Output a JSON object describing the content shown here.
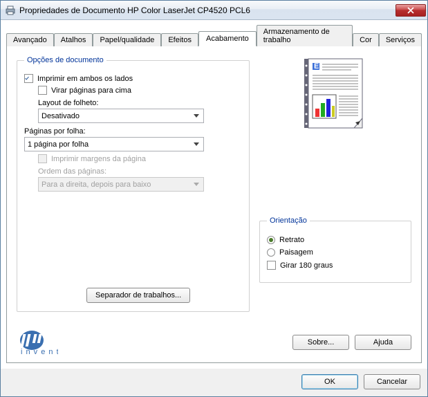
{
  "window": {
    "title": "Propriedades de Documento HP Color LaserJet CP4520 PCL6"
  },
  "tabs": {
    "items": [
      "Avançado",
      "Atalhos",
      "Papel/qualidade",
      "Efeitos",
      "Acabamento",
      "Armazenamento de trabalho",
      "Cor",
      "Serviços"
    ],
    "active_index": 4
  },
  "doc_options": {
    "legend": "Opções de documento",
    "print_both_sides": {
      "label": "Imprimir em ambos os lados",
      "checked": true
    },
    "flip_pages_up": {
      "label": "Virar páginas para cima",
      "checked": false
    },
    "booklet_layout_label": "Layout de folheto:",
    "booklet_layout_value": "Desativado",
    "pages_per_sheet_label": "Páginas por folha:",
    "pages_per_sheet_value": "1 página por folha",
    "print_page_borders": {
      "label": "Imprimir margens da página",
      "checked": false,
      "disabled": true
    },
    "page_order_label": "Ordem das páginas:",
    "page_order_value": "Para a direita, depois para baixo",
    "separator_button": "Separador de trabalhos..."
  },
  "orientation": {
    "legend": "Orientação",
    "portrait": "Retrato",
    "landscape": "Paisagem",
    "rotate180": {
      "label": "Girar 180 graus",
      "checked": false
    },
    "selected": "portrait"
  },
  "buttons": {
    "about": "Sobre...",
    "help": "Ajuda",
    "ok": "OK",
    "cancel": "Cancelar"
  }
}
